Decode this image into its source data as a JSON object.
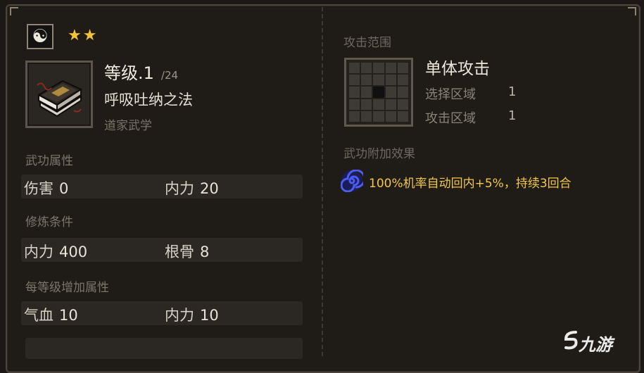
{
  "header": {
    "school_icon": "taiji-icon",
    "stars": "★★"
  },
  "skill": {
    "level": "等级.1",
    "level_max": "/24",
    "name": "呼吸吐纳之法",
    "school": "道家武学",
    "icon": "book-icon"
  },
  "sections": {
    "attributes": {
      "label": "武功属性",
      "items": [
        {
          "name": "伤害",
          "value": "0"
        },
        {
          "name": "内力",
          "value": "20"
        }
      ]
    },
    "requirements": {
      "label": "修炼条件",
      "items": [
        {
          "name": "内力",
          "value": "400"
        },
        {
          "name": "根骨",
          "value": "8"
        }
      ]
    },
    "per_level": {
      "label": "每等级增加属性",
      "items": [
        {
          "name": "气血",
          "value": "10"
        },
        {
          "name": "内力",
          "value": "10"
        }
      ]
    }
  },
  "attack_range": {
    "label": "攻击范围",
    "type": "单体攻击",
    "select_label": "选择区域",
    "select_value": "1",
    "attack_label": "攻击区域",
    "attack_value": "1"
  },
  "effects": {
    "label": "武功附加效果",
    "items": [
      {
        "icon": "spiral-icon",
        "text": "100%机率自动回内+5%，持续3回合"
      }
    ]
  },
  "watermark": {
    "text": "九游"
  },
  "colors": {
    "star": "#f2c23a",
    "effect_text": "#f1c64a",
    "spiral": "#3a48d8"
  }
}
